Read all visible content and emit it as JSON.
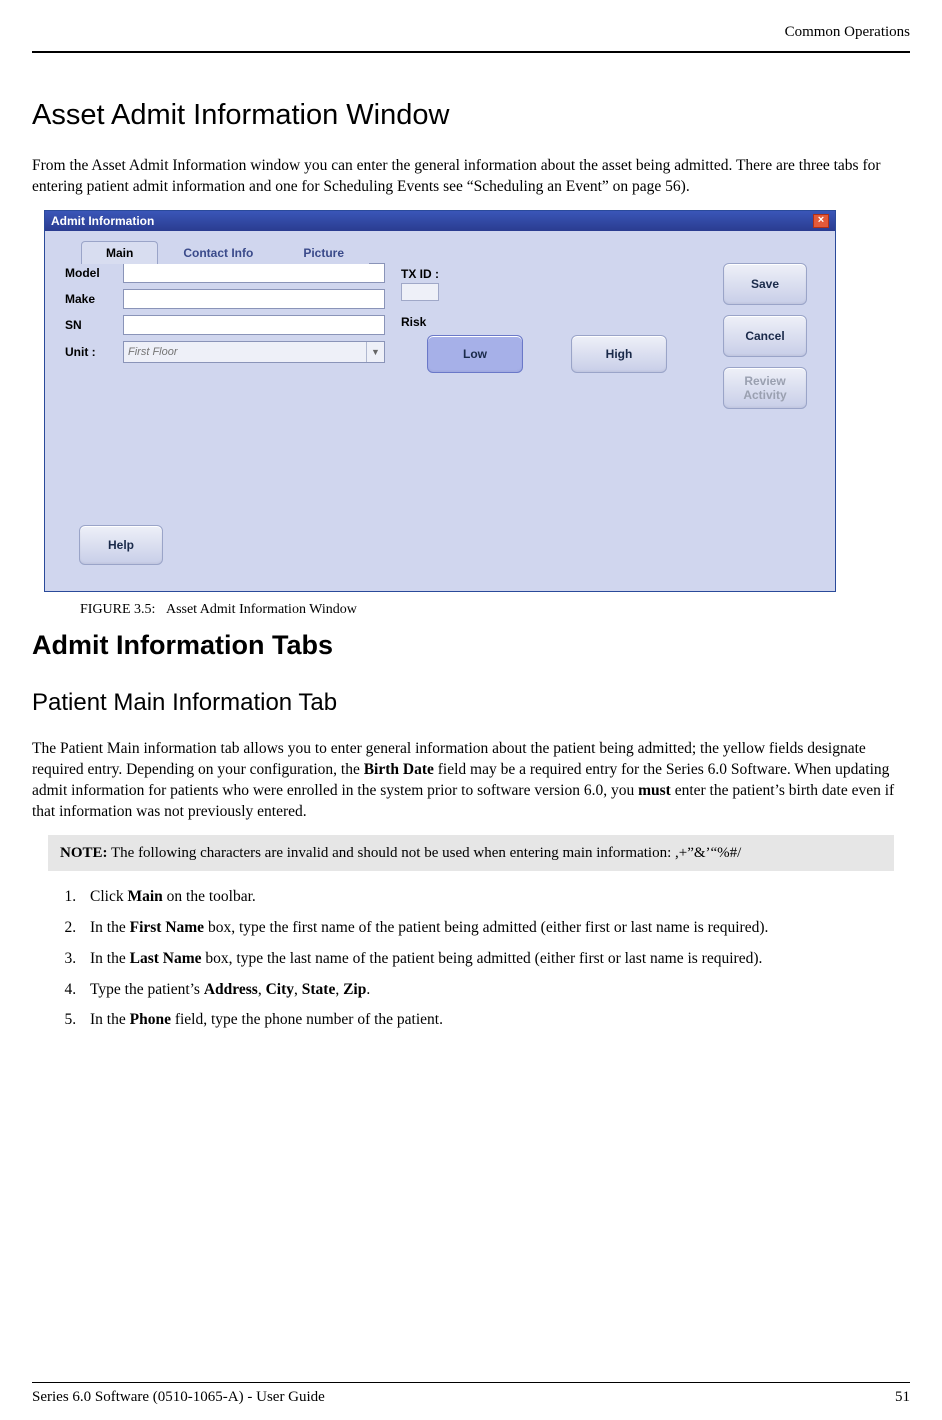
{
  "header": {
    "section": "Common Operations"
  },
  "h1": "Asset Admit Information Window",
  "intro": "From the Asset Admit Information window you can enter the general information about the asset being admitted. There are three tabs for entering patient admit information and one for Scheduling Events see “Scheduling an Event” on page 56).",
  "window": {
    "title": "Admit Information",
    "close": "×",
    "tabs": {
      "main": "Main",
      "contact": "Contact Info",
      "picture": "Picture"
    },
    "fields": {
      "model": "Model",
      "make": "Make",
      "sn": "SN",
      "unit": "Unit :",
      "unit_placeholder": "First Floor"
    },
    "txid_label": "TX ID :",
    "risk": {
      "label": "Risk",
      "low": "Low",
      "high": "High"
    },
    "buttons": {
      "save": "Save",
      "cancel": "Cancel",
      "review": "Review Activity",
      "help": "Help"
    }
  },
  "figure": {
    "label": "FIGURE 3.5:",
    "caption": "Asset Admit Information Window"
  },
  "h2": "Admit Information Tabs",
  "h3": "Patient Main Information Tab",
  "para2_parts": {
    "a": "The Patient Main information tab allows you to enter general information about the patient being admitted; the yellow fields designate required entry. Depending on your configuration, the ",
    "b": "Birth Date",
    "c": " field may be a required entry for the Series 6.0 Software. When updating admit information for patients who were enrolled in the system prior to software version 6.0, you ",
    "d": "must",
    "e": " enter the patient’s birth date even if that information was not previously entered."
  },
  "note": {
    "lead": "NOTE:",
    "text": " The following characters are invalid and should not be used when entering main information: ,+”&’“%#/"
  },
  "steps": {
    "s1a": "Click ",
    "s1b": "Main",
    "s1c": " on the toolbar.",
    "s2a": "In the ",
    "s2b": "First Name",
    "s2c": " box, type the first name of the patient being admitted (either first or last name is required).",
    "s3a": "In the ",
    "s3b": "Last Name",
    "s3c": " box, type the last name of the patient being admitted (either first or last name is required).",
    "s4a": "Type the patient’s ",
    "s4b": "Address",
    "s4c": ", ",
    "s4d": "City",
    "s4e": ", ",
    "s4f": "State",
    "s4g": ", ",
    "s4h": "Zip",
    "s4i": ".",
    "s5a": "In the ",
    "s5b": "Phone",
    "s5c": " field, type the phone number of the patient."
  },
  "footer": {
    "left": "Series 6.0 Software (0510-1065-A) - User Guide",
    "right": "51"
  }
}
